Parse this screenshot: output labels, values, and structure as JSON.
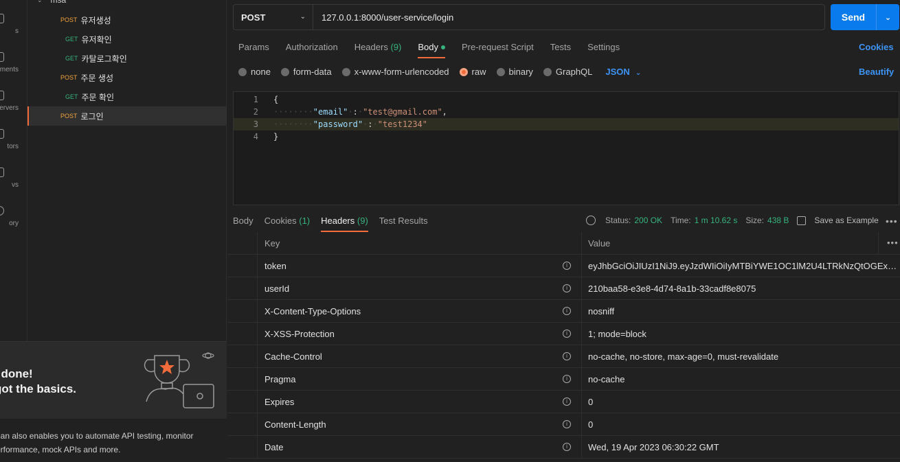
{
  "sidebar": {
    "rail": [
      {
        "label": "s"
      },
      {
        "label": "ments"
      },
      {
        "label": "ervers"
      },
      {
        "label": "tors"
      },
      {
        "label": "vs"
      },
      {
        "label": "ory"
      }
    ],
    "collection": "msa",
    "items": [
      {
        "method": "POST",
        "name": "유저생성"
      },
      {
        "method": "GET",
        "name": "유저확인"
      },
      {
        "method": "GET",
        "name": "카탈로그확인"
      },
      {
        "method": "POST",
        "name": "주문 생성"
      },
      {
        "method": "GET",
        "name": "주문 확인"
      },
      {
        "method": "POST",
        "name": "로그인"
      }
    ],
    "promo": {
      "heading_line1": "l done!",
      "heading_line2": "got the basics.",
      "body_line1": "nan also enables you to automate API testing, monitor",
      "body_line2": "erformance, mock APIs and more."
    }
  },
  "request": {
    "method": "POST",
    "url": "127.0.0.1:8000/user-service/login",
    "send_label": "Send",
    "tabs": [
      {
        "label": "Params"
      },
      {
        "label": "Authorization"
      },
      {
        "label": "Headers",
        "count": "(9)"
      },
      {
        "label": "Body"
      },
      {
        "label": "Pre-request Script"
      },
      {
        "label": "Tests"
      },
      {
        "label": "Settings"
      }
    ],
    "cookies_label": "Cookies",
    "body_types": [
      "none",
      "form-data",
      "x-www-form-urlencoded",
      "raw",
      "binary",
      "GraphQL"
    ],
    "raw_format": "JSON",
    "beautify_label": "Beautify",
    "code": {
      "line_numbers": [
        "1",
        "2",
        "3",
        "4"
      ],
      "open": "{",
      "close": "}",
      "email_key": "\"email\"",
      "email_value": "\"test@gmail.com\"",
      "password_key": "\"password\"",
      "password_value": "\"test1234\""
    }
  },
  "response": {
    "tabs": [
      {
        "label": "Body"
      },
      {
        "label": "Cookies",
        "count": "(1)"
      },
      {
        "label": "Headers",
        "count": "(9)"
      },
      {
        "label": "Test Results"
      }
    ],
    "status_label": "Status:",
    "status_value": "200 OK",
    "time_label": "Time:",
    "time_value": "1 m 10.62 s",
    "size_label": "Size:",
    "size_value": "438 B",
    "save_label": "Save as Example",
    "headers_table": {
      "columns": [
        "Key",
        "Value"
      ],
      "rows": [
        {
          "key": "token",
          "value": "eyJhbGciOiJIUzI1NiJ9.eyJzdWIiOiIyMTBiYWE1OC1lM2U4LTRkNzQtOGExYi0zM..."
        },
        {
          "key": "userId",
          "value": "210baa58-e3e8-4d74-8a1b-33cadf8e8075"
        },
        {
          "key": "X-Content-Type-Options",
          "value": "nosniff"
        },
        {
          "key": "X-XSS-Protection",
          "value": "1; mode=block"
        },
        {
          "key": "Cache-Control",
          "value": "no-cache, no-store, max-age=0, must-revalidate"
        },
        {
          "key": "Pragma",
          "value": "no-cache"
        },
        {
          "key": "Expires",
          "value": "0"
        },
        {
          "key": "Content-Length",
          "value": "0"
        },
        {
          "key": "Date",
          "value": "Wed, 19 Apr 2023 06:30:22 GMT"
        }
      ]
    }
  },
  "colors": {
    "accent": "#f26b3a",
    "send": "#097bed",
    "link": "#3d94f6",
    "success": "#36b37e",
    "post": "#f0a33c"
  }
}
